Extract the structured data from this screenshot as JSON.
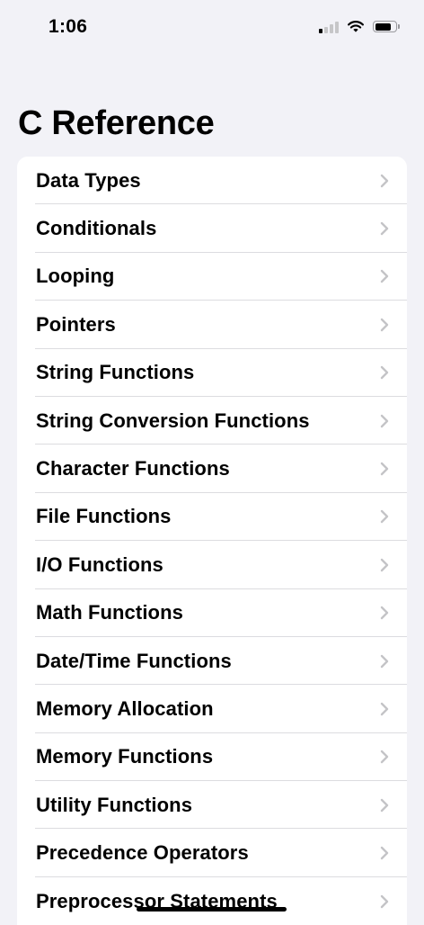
{
  "status_bar": {
    "time": "1:06",
    "icons": [
      "cellular-signal-icon",
      "wifi-icon",
      "battery-icon"
    ],
    "signal_bars_active": 1,
    "signal_bars_total": 4,
    "battery_level": 0.8
  },
  "nav": {
    "title": "C Reference"
  },
  "list": {
    "items": [
      {
        "label": "Data Types"
      },
      {
        "label": "Conditionals"
      },
      {
        "label": "Looping"
      },
      {
        "label": "Pointers"
      },
      {
        "label": "String Functions"
      },
      {
        "label": "String Conversion Functions"
      },
      {
        "label": "Character Functions"
      },
      {
        "label": "File Functions"
      },
      {
        "label": "I/O Functions"
      },
      {
        "label": "Math Functions"
      },
      {
        "label": "Date/Time Functions"
      },
      {
        "label": "Memory Allocation"
      },
      {
        "label": "Memory Functions"
      },
      {
        "label": "Utility Functions"
      },
      {
        "label": "Precedence Operators"
      },
      {
        "label": "Preprocessor Statements"
      }
    ],
    "disclosure_icon": "chevron-right-icon"
  },
  "colors": {
    "background": "#f2f2f7",
    "card": "#ffffff",
    "separator": "#dcdce0",
    "chevron": "#c4c4c7",
    "text": "#000000"
  }
}
